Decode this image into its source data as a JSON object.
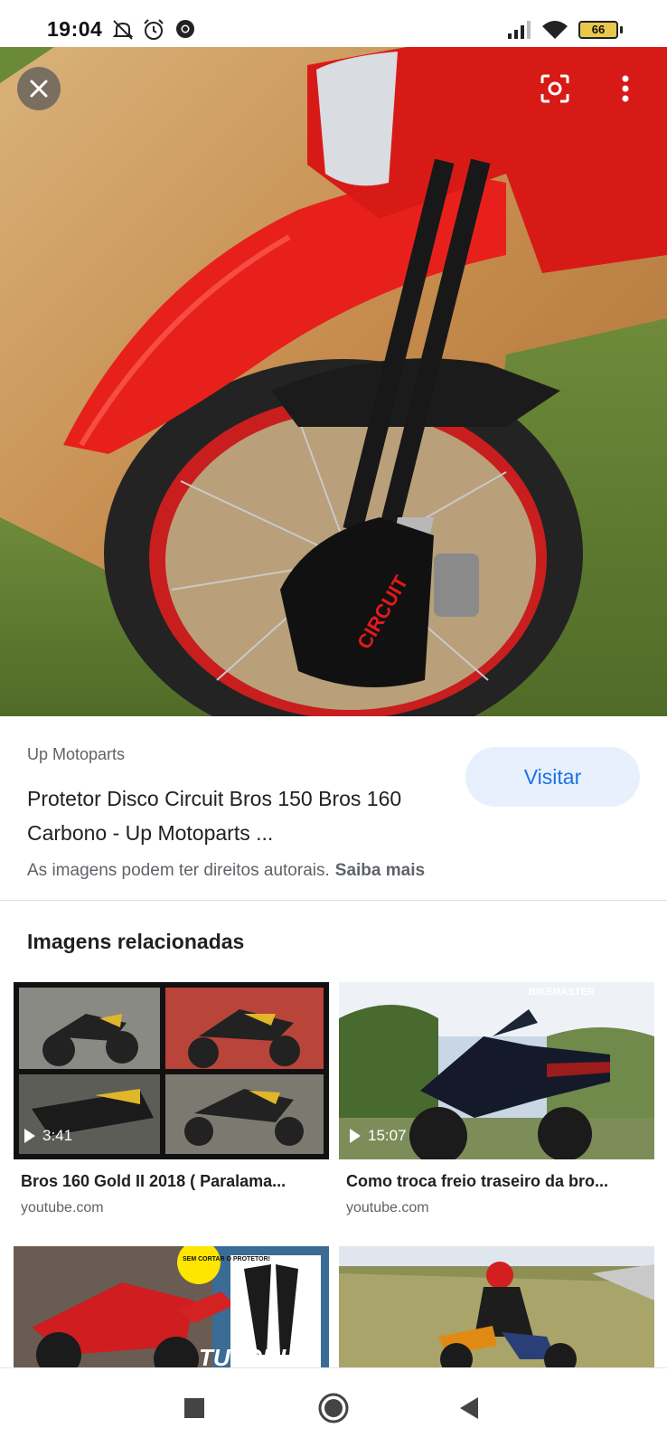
{
  "status_bar": {
    "time": "19:04",
    "battery": "66",
    "icons": [
      "do-not-disturb-icon",
      "alarm-icon",
      "chrome-icon",
      "signal-icon",
      "wifi-icon",
      "battery-icon"
    ]
  },
  "viewer": {
    "close_icon": "close-icon",
    "lens_icon": "lens-icon",
    "more_icon": "more-vert-icon",
    "image_text": "CIRCUIT"
  },
  "result": {
    "source": "Up Motoparts",
    "title": "Protetor Disco Circuit Bros 150 Bros 160 Carbono - Up Motoparts ...",
    "visit_label": "Visitar",
    "copyright_text": "As imagens podem ter direitos autorais.",
    "learn_more": "Saiba mais"
  },
  "related": {
    "heading": "Imagens relacionadas",
    "items": [
      {
        "title": "Bros 160 Gold II 2018 ( Paralama...",
        "domain": "youtube.com",
        "duration": "3:41"
      },
      {
        "title": "Como troca freio traseiro da bro...",
        "domain": "youtube.com",
        "duration": "15:07",
        "watermark": "BIKEMASTER"
      },
      {
        "title": "",
        "domain": "",
        "thumb_text": "TUTORIAL",
        "badge_text": "SEM CORTAR O PROTETOR!"
      },
      {
        "title": "",
        "domain": ""
      }
    ]
  },
  "nav": {
    "icons": [
      "recents-square-icon",
      "home-circle-icon",
      "back-triangle-icon"
    ]
  },
  "colors": {
    "accent": "#1a73e8",
    "visit_bg": "#e8f0fe",
    "moto_red": "#e8201c"
  }
}
